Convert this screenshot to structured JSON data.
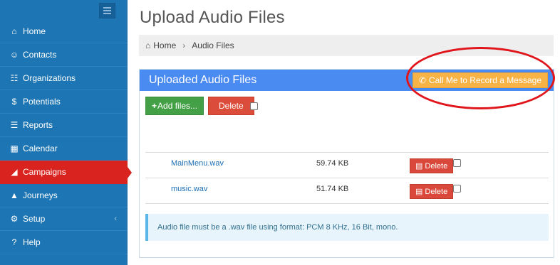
{
  "sidebar": {
    "menu_icon": "hamburger-icon",
    "items": [
      {
        "label": "Home",
        "icon": "home-icon",
        "glyph": "⌂"
      },
      {
        "label": "Contacts",
        "icon": "user-icon",
        "glyph": "☺"
      },
      {
        "label": "Organizations",
        "icon": "sitemap-icon",
        "glyph": "☷"
      },
      {
        "label": "Potentials",
        "icon": "dollar-icon",
        "glyph": "$"
      },
      {
        "label": "Reports",
        "icon": "file-icon",
        "glyph": "☰"
      },
      {
        "label": "Calendar",
        "icon": "calendar-icon",
        "glyph": "▦"
      },
      {
        "label": "Campaigns",
        "icon": "rss-icon",
        "glyph": "◢",
        "active": true
      },
      {
        "label": "Journeys",
        "icon": "road-icon",
        "glyph": "▲"
      },
      {
        "label": "Setup",
        "icon": "cogs-icon",
        "glyph": "⚙",
        "chevron": "‹"
      },
      {
        "label": "Help",
        "icon": "question-icon",
        "glyph": "?"
      }
    ]
  },
  "page": {
    "title": "Upload Audio Files"
  },
  "breadcrumb": {
    "home": "Home",
    "separator": "›",
    "current": "Audio Files"
  },
  "panel": {
    "heading": "Uploaded Audio Files",
    "call_button": "Call Me to Record a Message",
    "add_button": "Add files...",
    "delete_button": "Delete"
  },
  "files": [
    {
      "name": "MainMenu.wav",
      "size": "59.74 KB",
      "delete_label": "Delete"
    },
    {
      "name": "music.wav",
      "size": "51.74 KB",
      "delete_label": "Delete"
    }
  ],
  "info": {
    "text": "Audio file must be a .wav file using format: PCM 8 KHz, 16 Bit, mono."
  },
  "colors": {
    "sidebar": "#1d75b3",
    "active": "#d9231f",
    "panel_heading": "#4a8bf2",
    "call_button": "#f8b347",
    "annotation": "#e0161c"
  }
}
